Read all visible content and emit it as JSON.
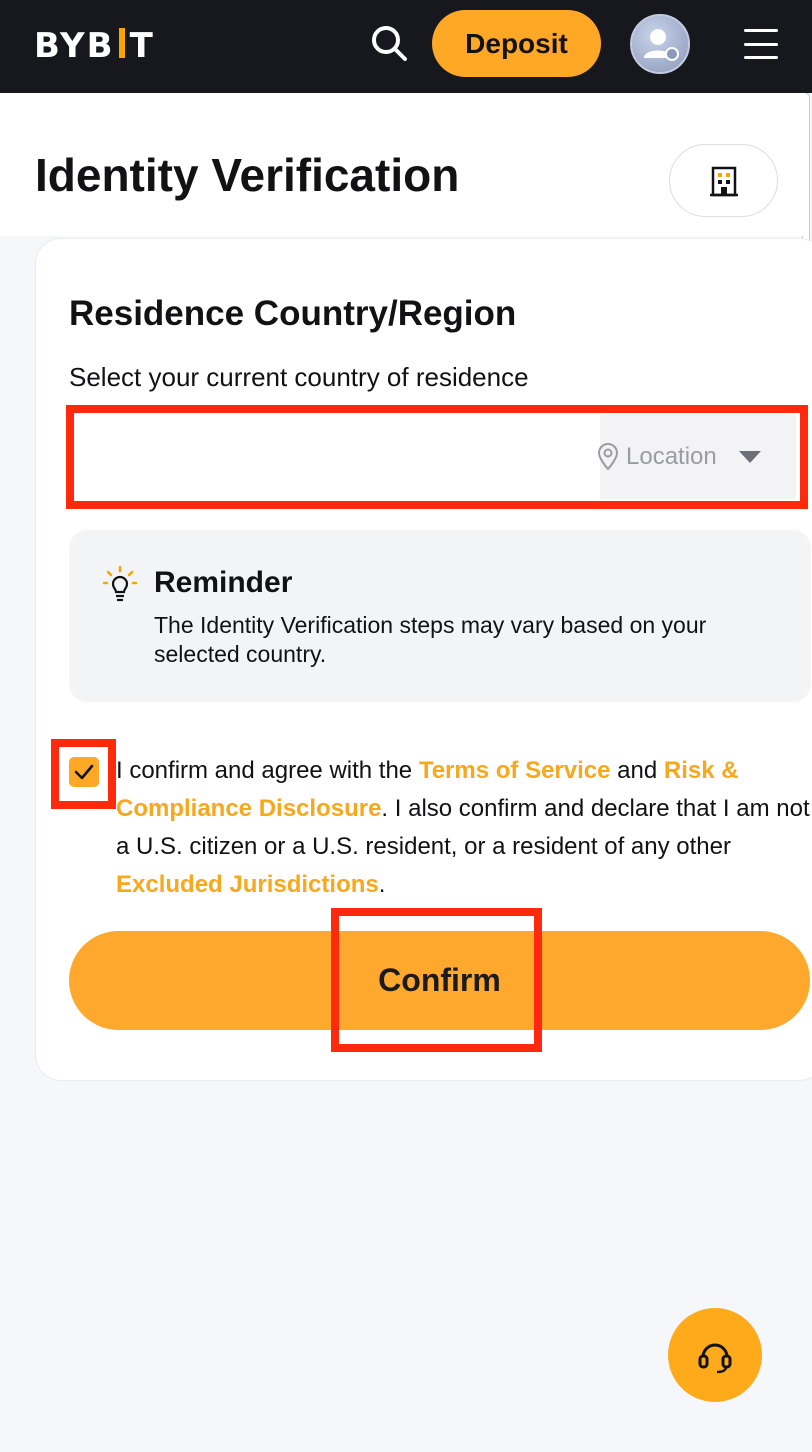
{
  "header": {
    "logo_text": "BYB",
    "logo_text_end": "T",
    "deposit_label": "Deposit",
    "icons": {
      "search": "search-icon",
      "avatar": "user-avatar-icon",
      "menu": "hamburger-menu-icon"
    }
  },
  "page": {
    "title": "Identity Verification",
    "business_icon": "building-icon"
  },
  "residence": {
    "title": "Residence Country/Region",
    "subtitle": "Select your current country of residence",
    "selected_value": "",
    "location_label": "Location"
  },
  "reminder": {
    "title": "Reminder",
    "text": "The Identity Verification steps may vary based on your selected country."
  },
  "agreement": {
    "checked": true,
    "text_1": "I confirm and agree with the ",
    "link_terms": "Terms of Service",
    "text_2": " and ",
    "link_risk": "Risk & Compliance Disclosure",
    "text_3": ". I also confirm and declare that I am not a U.S. citizen or a U.S. resident, or a resident of any other ",
    "link_excluded": "Excluded Jurisdictions",
    "text_4": "."
  },
  "confirm_label": "Confirm",
  "colors": {
    "accent": "#ffa826",
    "link": "#f7a81d",
    "highlight": "#ff2a0d",
    "topbar": "#17181e"
  }
}
